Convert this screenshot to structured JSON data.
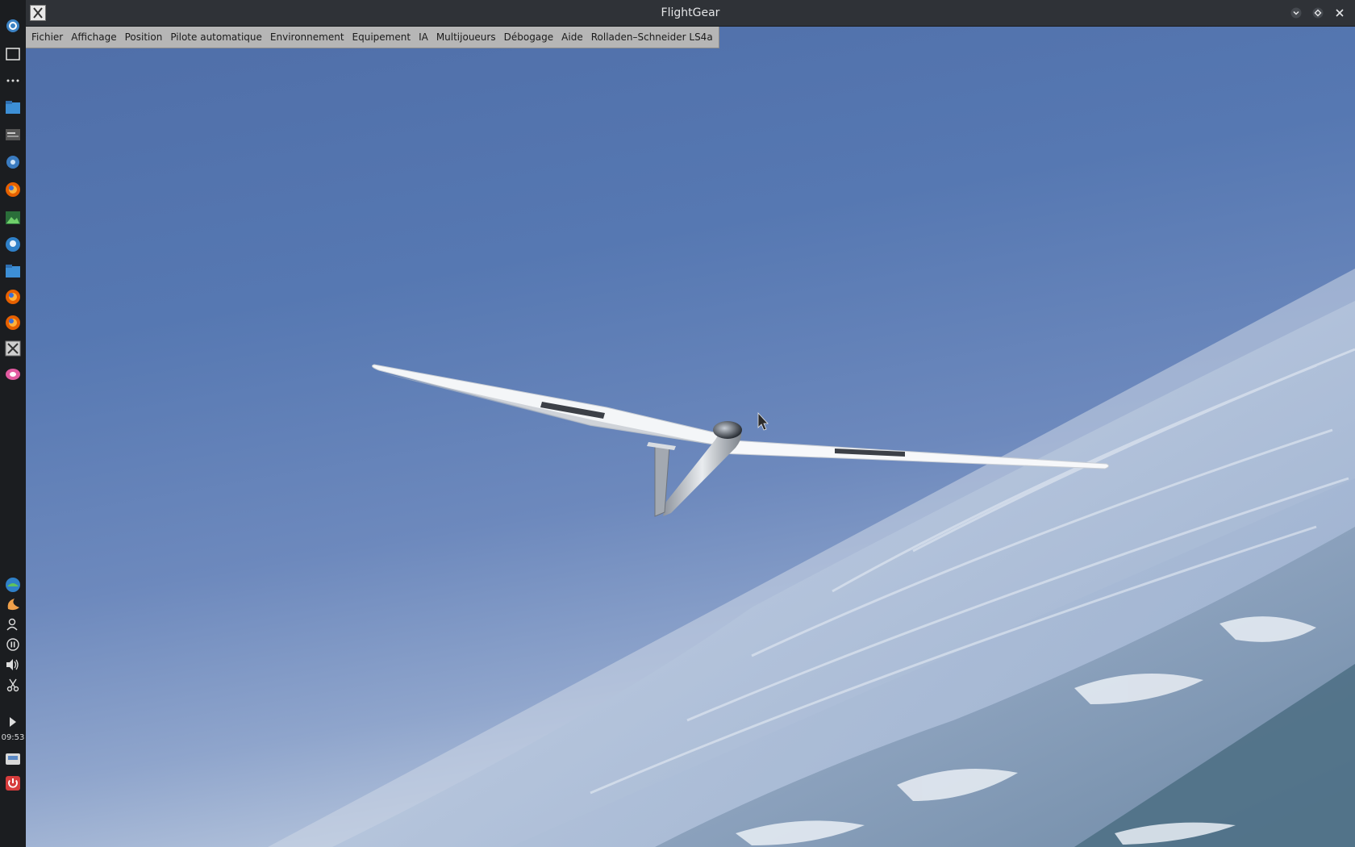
{
  "window": {
    "title": "FlightGear"
  },
  "menubar": {
    "items": [
      {
        "label": "Fichier"
      },
      {
        "label": "Affichage"
      },
      {
        "label": "Position"
      },
      {
        "label": "Pilote automatique"
      },
      {
        "label": "Environnement"
      },
      {
        "label": "Equipement"
      },
      {
        "label": "IA"
      },
      {
        "label": "Multijoueurs"
      },
      {
        "label": "Débogage"
      },
      {
        "label": "Aide"
      },
      {
        "label": "Rolladen–Schneider LS4a"
      }
    ]
  },
  "dock": {
    "clock": "09:53",
    "icons": [
      "power-settings-icon",
      "desktop-icon",
      "more-icon",
      "files-icon",
      "terminal-icon",
      "settings-icon",
      "firefox-icon",
      "image-viewer-icon",
      "chat-icon",
      "folder-icon",
      "firefox-icon",
      "firefox-icon",
      "flightgear-icon",
      "media-icon",
      "network-icon",
      "night-light-icon",
      "user-icon",
      "pause-icon",
      "volume-icon",
      "scissors-icon",
      "play-icon",
      "drive-icon",
      "shutdown-icon"
    ]
  },
  "colors": {
    "sky_top": "#4f6ea8",
    "sky_horizon": "#d6dee9",
    "menubar": "#b6b6b6",
    "titlebar": "#2f3237"
  }
}
